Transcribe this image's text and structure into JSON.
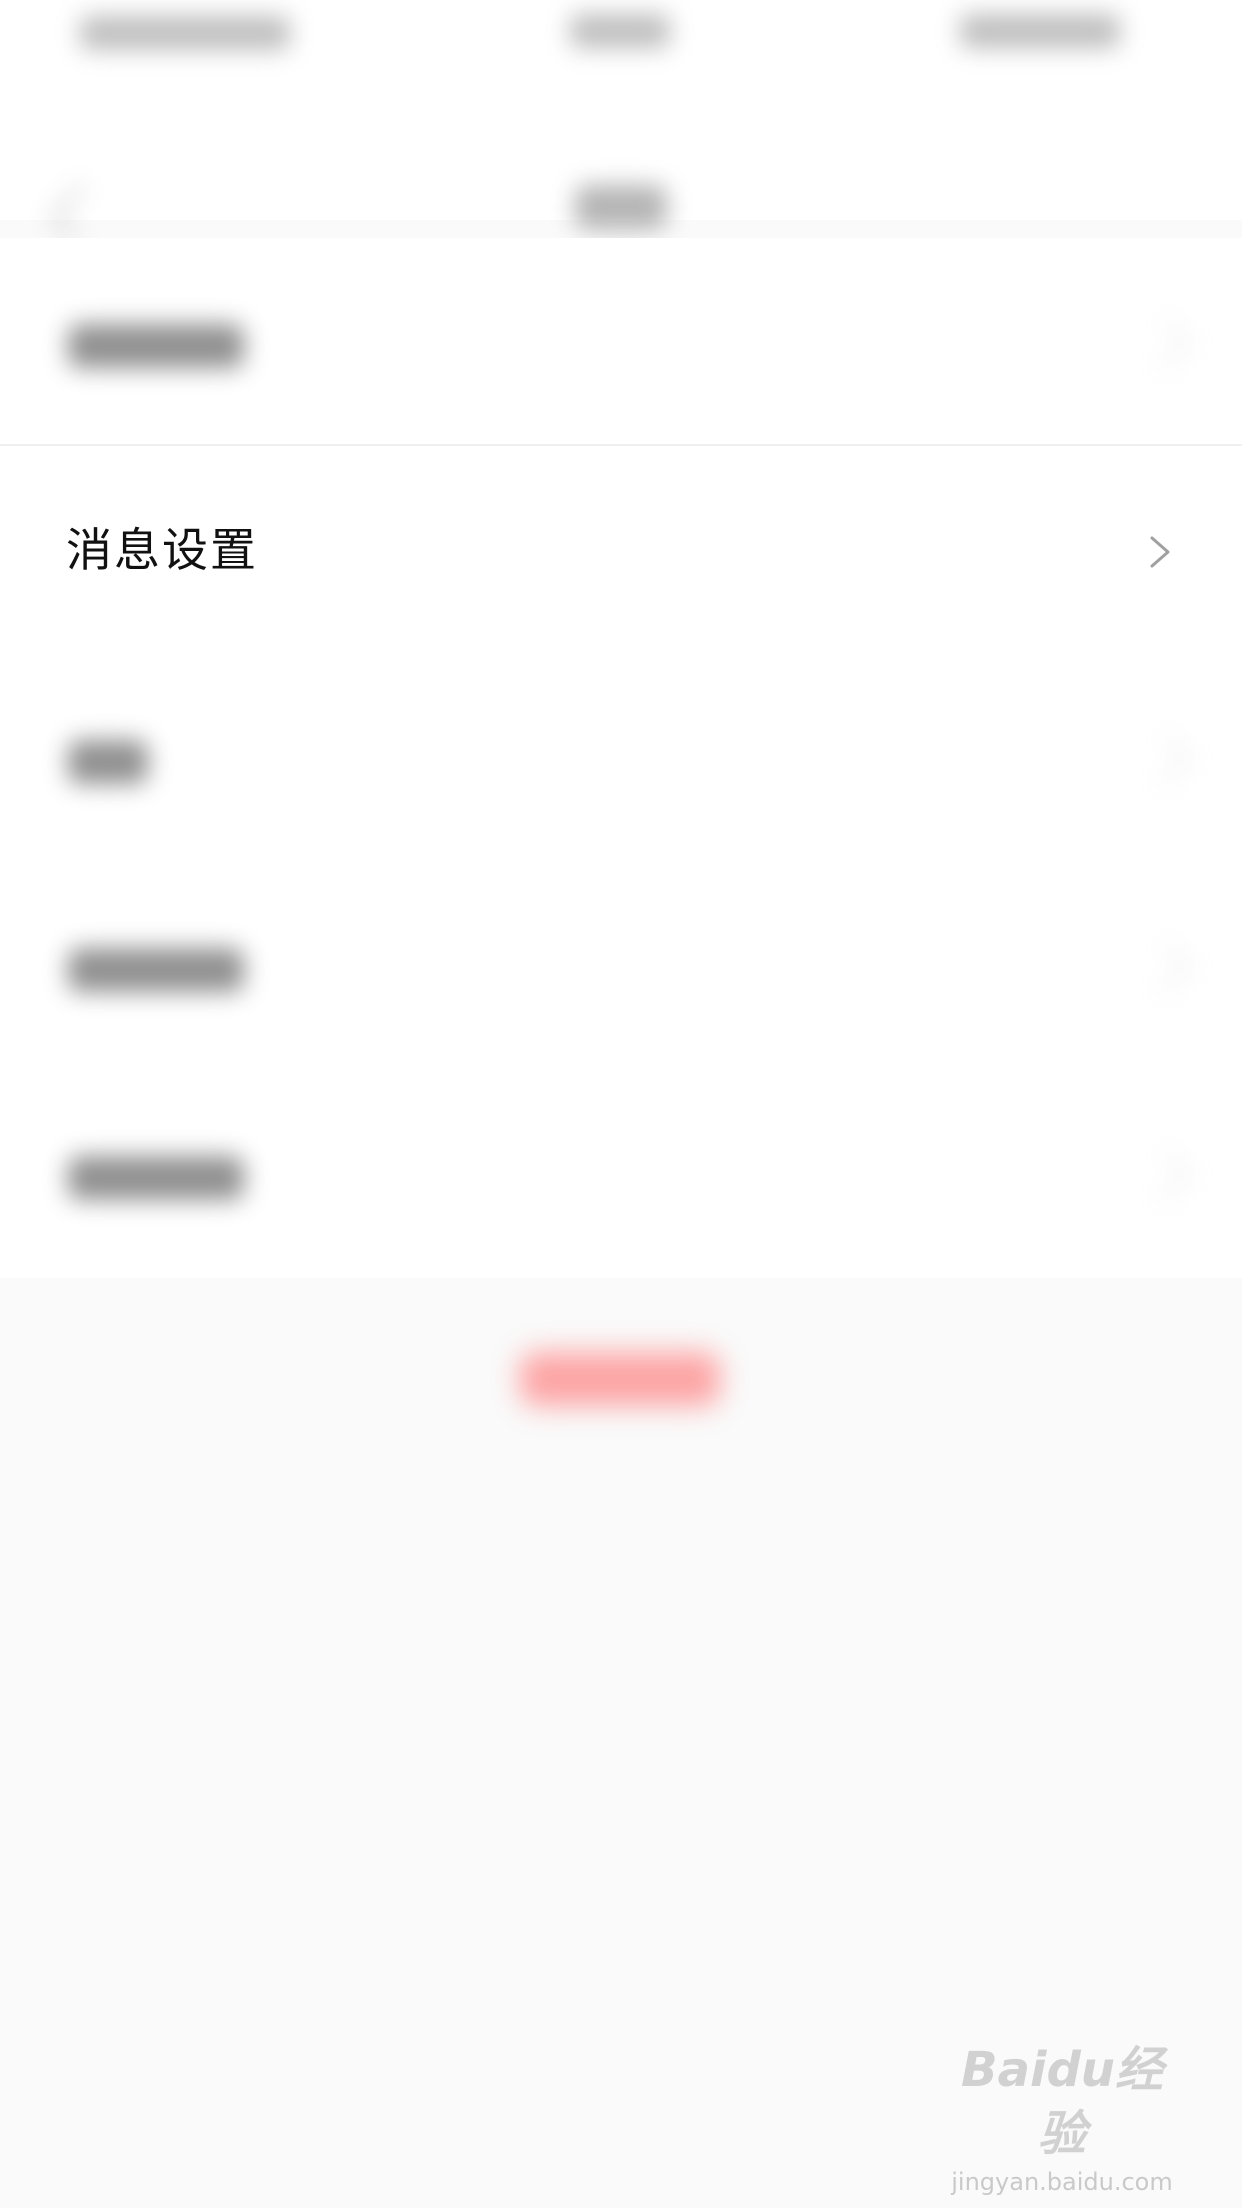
{
  "screen": {
    "row_message_settings": {
      "title": "消息设置"
    }
  },
  "watermark": {
    "logo": "Baidu经验",
    "url": "jingyan.baidu.com"
  },
  "colors": {
    "background": "#fafafa",
    "list_bg": "#ffffff",
    "divider": "#efefef",
    "primary_text": "#111111",
    "chevron": "#a0a0a0",
    "logout_button": "#ff6b6b"
  },
  "icons": {
    "back": "back-chevron-icon",
    "row_chevron": "chevron-right-icon"
  }
}
